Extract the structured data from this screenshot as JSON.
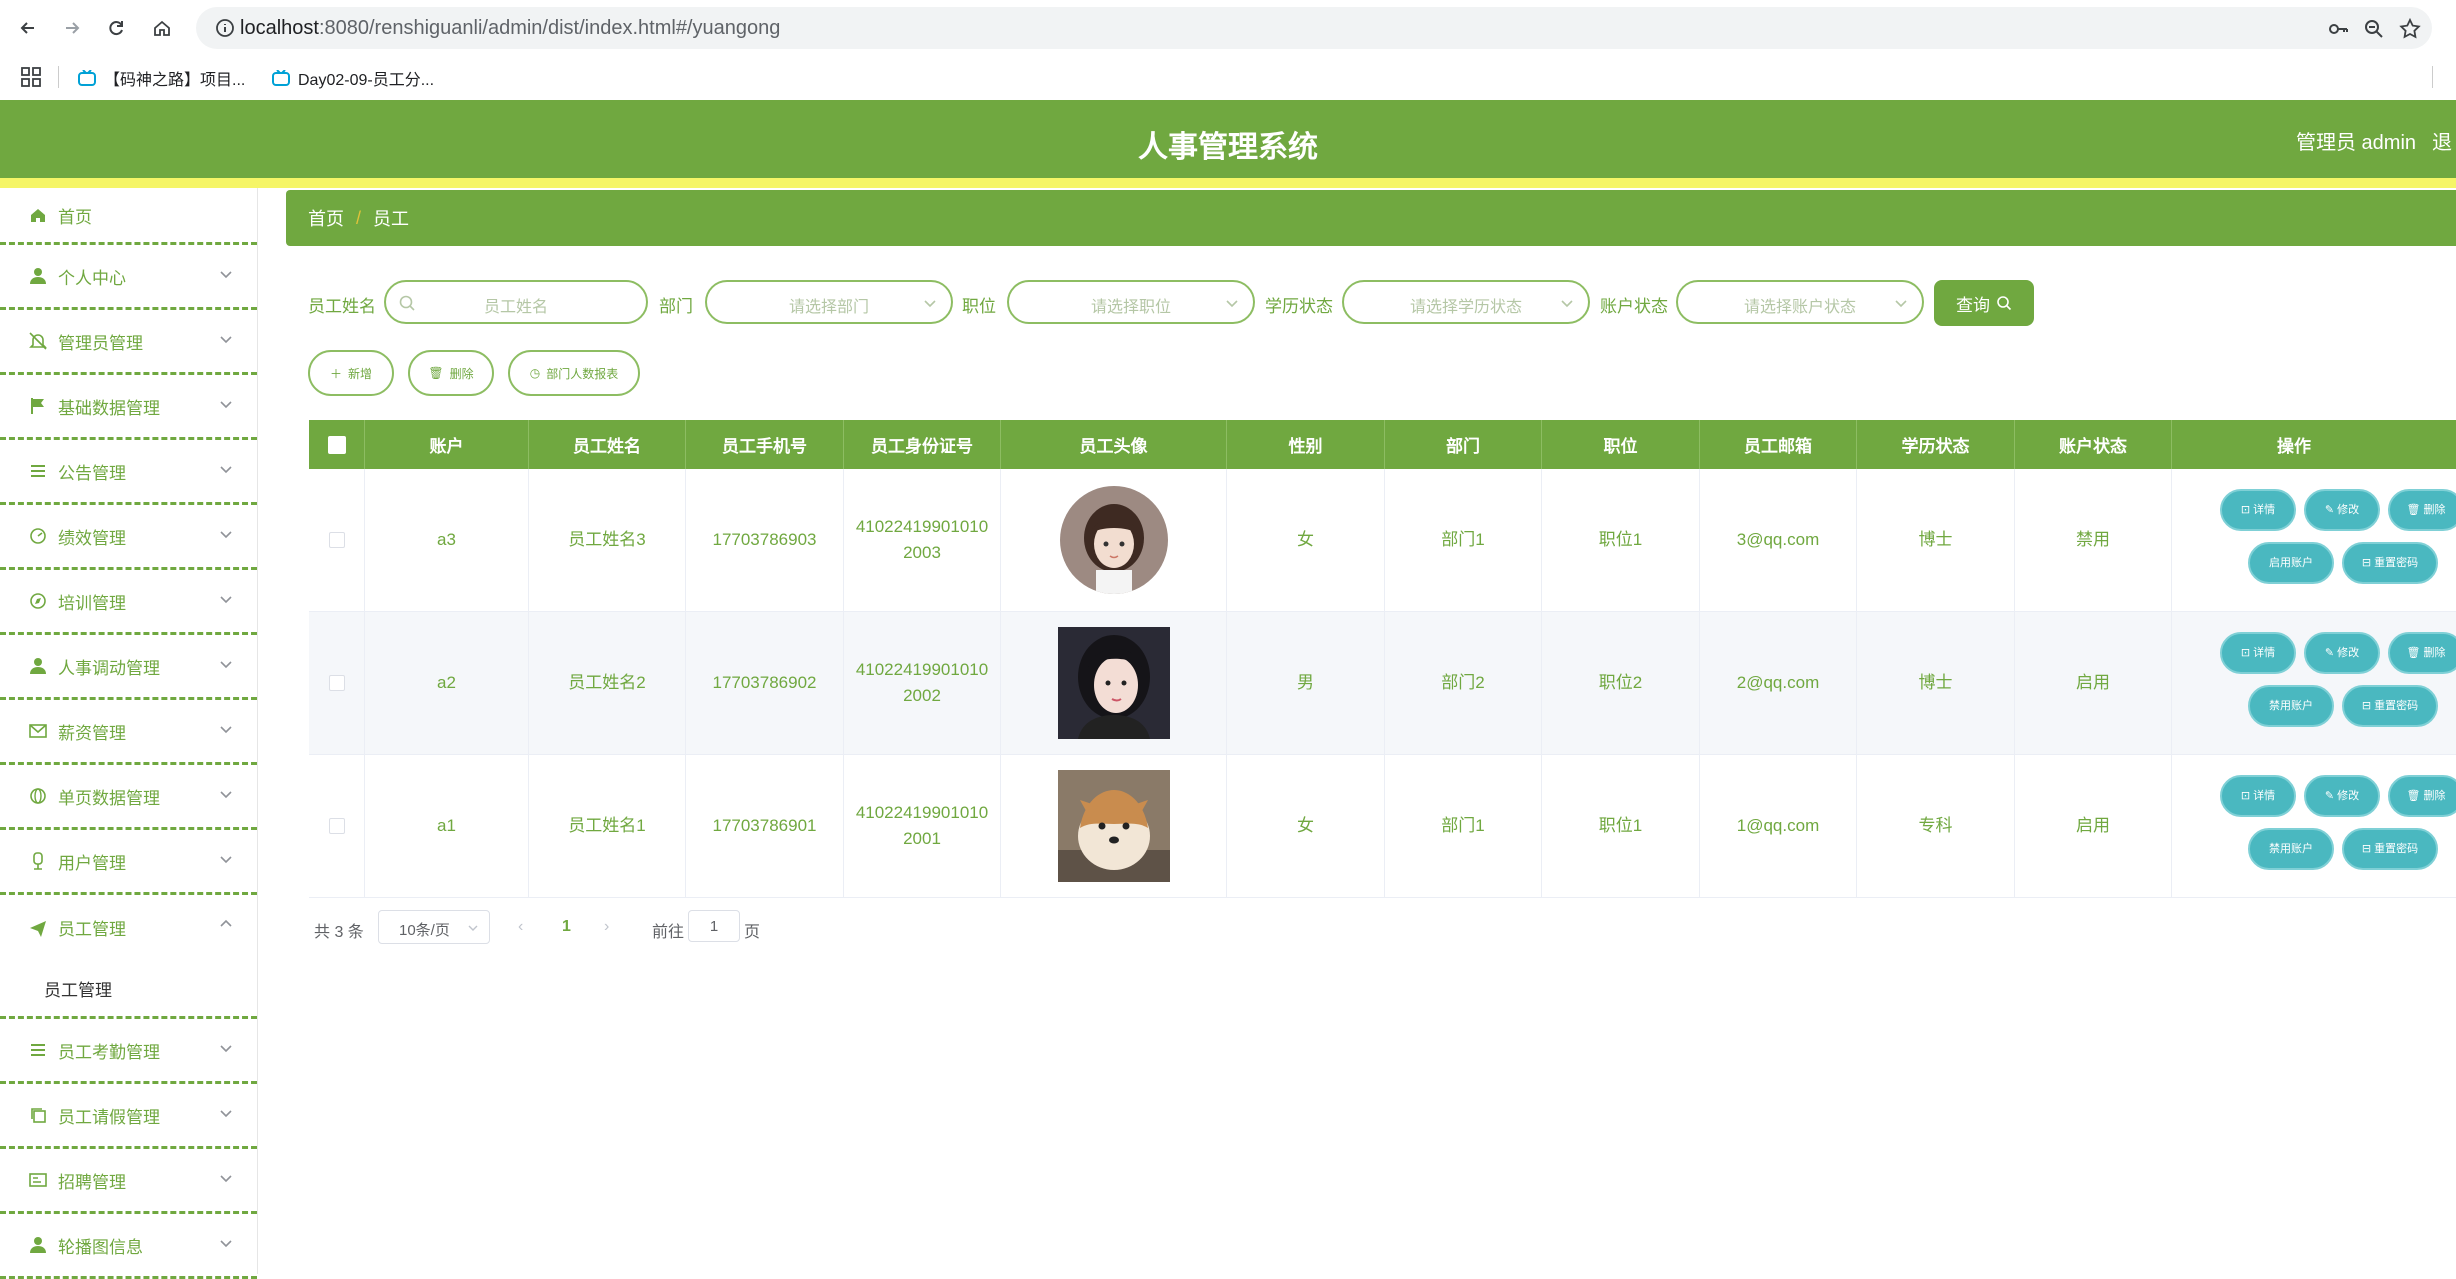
{
  "browser": {
    "url_host": "localhost",
    "url_path": ":8080/renshiguanli/admin/dist/index.html#/yuangong",
    "bookmarks": [
      "【码神之路】项目...",
      "Day02-09-员工分..."
    ]
  },
  "header": {
    "title": "人事管理系统",
    "admin": "管理员 admin",
    "logout": "退"
  },
  "colors": {
    "primary": "#70a840",
    "accent": "#f5f567",
    "op_button": "#4ab8c0"
  },
  "sidebar": {
    "items": [
      {
        "label": "首页",
        "icon": "home-icon"
      },
      {
        "label": "个人中心",
        "icon": "user-icon"
      },
      {
        "label": "管理员管理",
        "icon": "bell-off-icon"
      },
      {
        "label": "基础数据管理",
        "icon": "flag-icon"
      },
      {
        "label": "公告管理",
        "icon": "list-icon"
      },
      {
        "label": "绩效管理",
        "icon": "gauge-icon"
      },
      {
        "label": "培训管理",
        "icon": "compass-icon"
      },
      {
        "label": "人事调动管理",
        "icon": "user-icon"
      },
      {
        "label": "薪资管理",
        "icon": "mail-icon"
      },
      {
        "label": "单页数据管理",
        "icon": "globe-icon"
      },
      {
        "label": "用户管理",
        "icon": "mic-icon"
      },
      {
        "label": "员工管理",
        "icon": "send-icon"
      },
      {
        "label": "员工考勤管理",
        "icon": "list-icon"
      },
      {
        "label": "员工请假管理",
        "icon": "copy-icon"
      },
      {
        "label": "招聘管理",
        "icon": "card-icon"
      },
      {
        "label": "轮播图信息",
        "icon": "user-icon"
      }
    ],
    "submenu_active": "员工管理"
  },
  "breadcrumb": {
    "home": "首页",
    "sep": "/",
    "current": "员工"
  },
  "filters": {
    "name_label": "员工姓名",
    "name_placeholder": "员工姓名",
    "dept_label": "部门",
    "dept_placeholder": "请选择部门",
    "pos_label": "职位",
    "pos_placeholder": "请选择职位",
    "edu_label": "学历状态",
    "edu_placeholder": "请选择学历状态",
    "acct_label": "账户状态",
    "acct_placeholder": "请选择账户状态",
    "query": "查询"
  },
  "actions": {
    "add": "新增",
    "delete": "删除",
    "report": "部门人数报表"
  },
  "table": {
    "headers": [
      "账户",
      "员工姓名",
      "员工手机号",
      "员工身份证号",
      "员工头像",
      "性别",
      "部门",
      "职位",
      "员工邮箱",
      "学历状态",
      "账户状态",
      "操作"
    ],
    "rows": [
      {
        "account": "a3",
        "name": "员工姓名3",
        "phone": "17703786903",
        "id1": "41022419901010",
        "id2": "2003",
        "gender": "女",
        "dept": "部门1",
        "pos": "职位1",
        "email": "3@qq.com",
        "edu": "博士",
        "status": "禁用",
        "toggle": "启用账户"
      },
      {
        "account": "a2",
        "name": "员工姓名2",
        "phone": "17703786902",
        "id1": "41022419901010",
        "id2": "2002",
        "gender": "男",
        "dept": "部门2",
        "pos": "职位2",
        "email": "2@qq.com",
        "edu": "博士",
        "status": "启用",
        "toggle": "禁用账户"
      },
      {
        "account": "a1",
        "name": "员工姓名1",
        "phone": "17703786901",
        "id1": "41022419901010",
        "id2": "2001",
        "gender": "女",
        "dept": "部门1",
        "pos": "职位1",
        "email": "1@qq.com",
        "edu": "专科",
        "status": "启用",
        "toggle": "禁用账户"
      }
    ],
    "ops": {
      "detail": "详情",
      "edit": "修改",
      "del": "删除",
      "reset": "重置密码"
    }
  },
  "pagination": {
    "total": "共 3 条",
    "page_size": "10条/页",
    "current": "1",
    "goto_prefix": "前往",
    "goto_value": "1",
    "goto_suffix": "页"
  }
}
